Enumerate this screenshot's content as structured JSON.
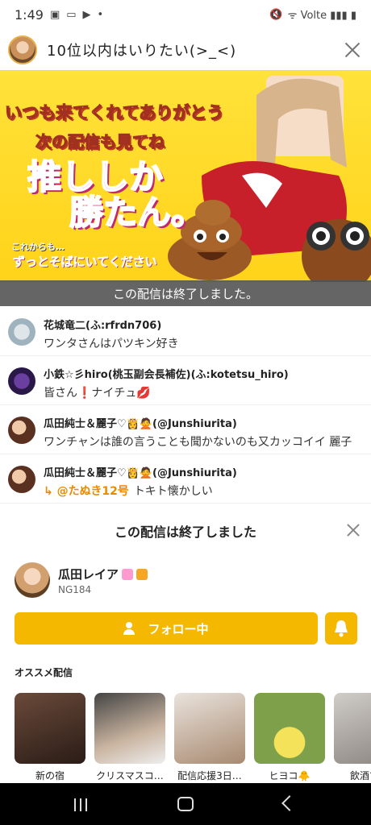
{
  "statusbar": {
    "time": "1:49",
    "right": "ᯤ Volte ▮▮▮ ▮"
  },
  "header": {
    "title": "10位以内はいりたい(>_<)"
  },
  "banner": {
    "line1": "いつも来てくれてありがとう",
    "line2": "次の配信も見てね",
    "big1": "推ししか",
    "big2": "勝たん。",
    "small1": "これからも…",
    "small2": "ずっとそばにいてください",
    "ended": "この配信は終了しました。"
  },
  "comments": [
    {
      "name": "花城竜二(ふ:rfrdn706)",
      "text": "ワンタさんはパツキン好き",
      "reply": ""
    },
    {
      "name": "小鉄☆彡hiro(桃玉副会長補佐)(ふ:kotetsu_hiro)",
      "text": "皆さん❗ナイチュ💋",
      "reply": ""
    },
    {
      "name": "瓜田純士＆麗子♡👸🙅(@Junshiurita)",
      "text": "ワンチャンは誰の言うことも聞かないのも又カッコイイ 麗子",
      "reply": ""
    },
    {
      "name": "瓜田純士＆麗子♡👸🙅(@Junshiurita)",
      "text": "トキト懐かしい",
      "reply": "↳ @たぬき12号"
    }
  ],
  "sheet": {
    "title": "この配信は終了しました",
    "streamer_name": "瓜田レイア",
    "streamer_id": "NG184",
    "follow_label": "フォロー中",
    "recommend_title": "オススメ配信",
    "recommend": [
      {
        "caption": "新の宿"
      },
      {
        "caption": "クリスマスコ…"
      },
      {
        "caption": "配信応援3日…"
      },
      {
        "caption": "ヒヨコ🐥"
      },
      {
        "caption": "飲酒で雑"
      }
    ]
  },
  "colors": {
    "accent": "#f5b800",
    "banner_bg": "#ffd319",
    "reply": "#e98b00"
  }
}
